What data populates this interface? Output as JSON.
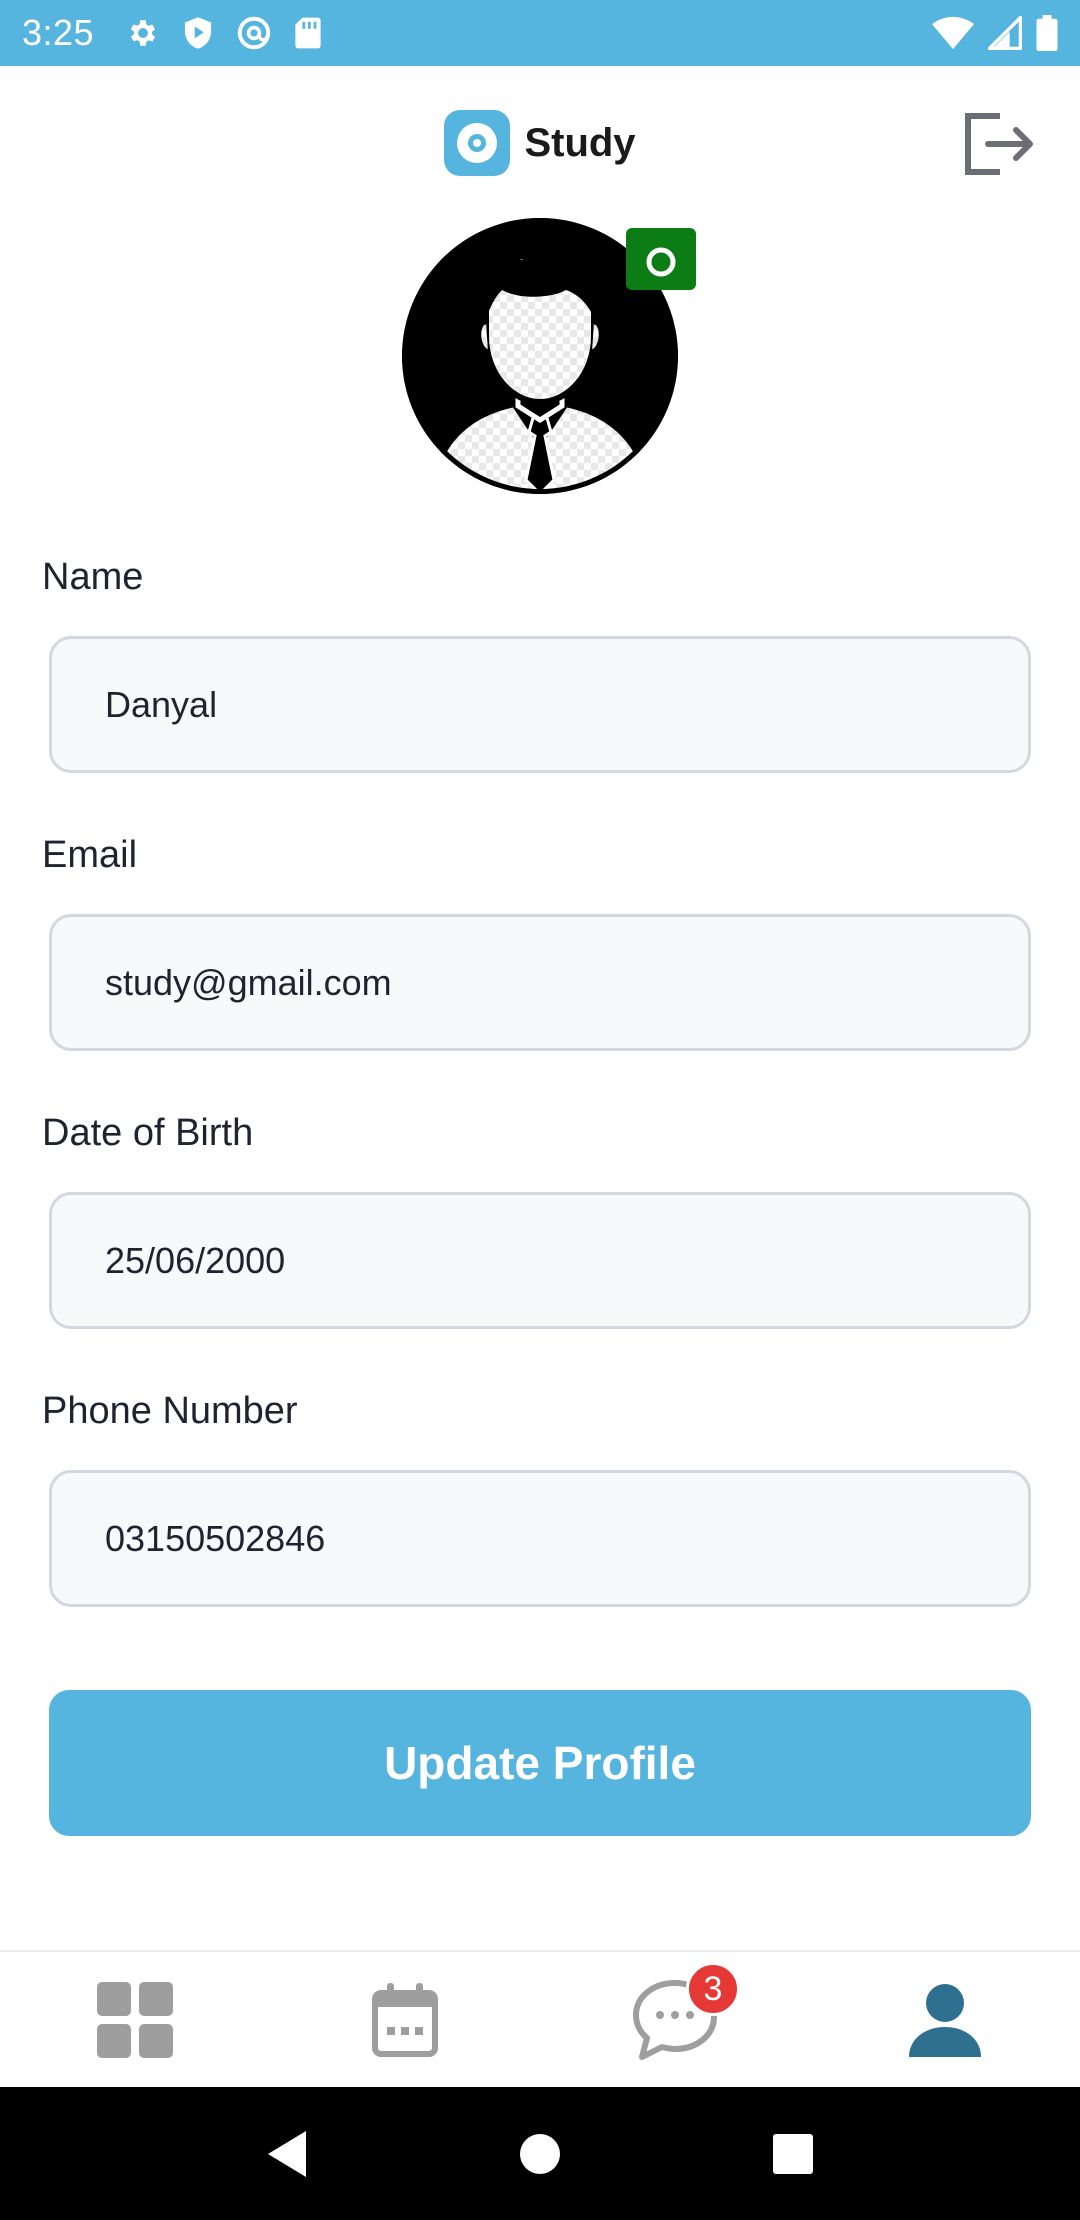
{
  "status_bar": {
    "time": "3:25",
    "left_icons": [
      "gear-icon",
      "shield-icon",
      "at-sign-icon",
      "sd-card-icon"
    ],
    "right_icons": [
      "wifi-icon",
      "cell-signal-icon",
      "battery-icon"
    ]
  },
  "header": {
    "title": "Study",
    "logo_icon": "app-logo-icon",
    "logout_icon": "logout-icon"
  },
  "profile": {
    "avatar_icon": "user-avatar-icon",
    "camera_icon": "camera-icon"
  },
  "form": {
    "fields": [
      {
        "label": "Name",
        "value": "Danyal"
      },
      {
        "label": "Email",
        "value": "study@gmail.com"
      },
      {
        "label": "Date of Birth",
        "value": "25/06/2000"
      },
      {
        "label": "Phone Number",
        "value": "03150502846"
      }
    ],
    "submit_label": "Update Profile"
  },
  "bottom_nav": {
    "items": [
      {
        "icon": "dashboard-grid-icon",
        "active": false
      },
      {
        "icon": "calendar-icon",
        "active": false
      },
      {
        "icon": "chat-icon",
        "active": false,
        "badge": "3"
      },
      {
        "icon": "profile-icon",
        "active": true
      }
    ]
  },
  "colors": {
    "accent": "#56b5de",
    "camera": "#0b7d14",
    "active_nav": "#2f6f8f",
    "inactive_nav": "#9e9e9e",
    "badge": "#e53935"
  }
}
